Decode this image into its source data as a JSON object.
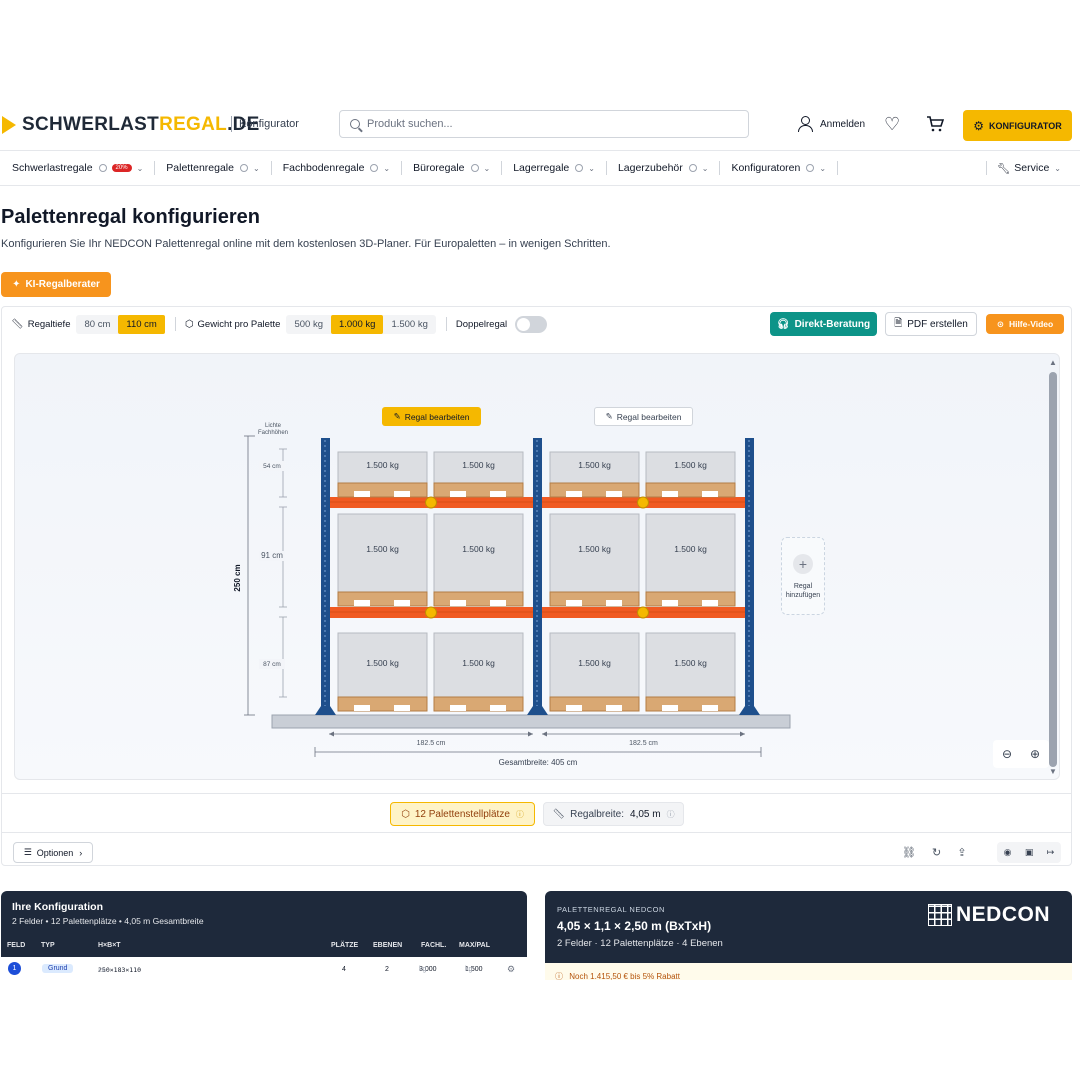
{
  "header": {
    "logo_main": "SCHWERLAST",
    "logo_accent": "REGAL",
    "logo_tld": ".DE",
    "logo_sub": "Konfigurator",
    "search_placeholder": "Produkt suchen...",
    "login_label": "Anmelden",
    "cta_label": "KONFIGURATOR"
  },
  "nav": {
    "items": [
      {
        "label": "Schwerlastregale",
        "badge": "20%"
      },
      {
        "label": "Palettenregale"
      },
      {
        "label": "Fachbodenregale"
      },
      {
        "label": "Büroregale"
      },
      {
        "label": "Lagerregale"
      },
      {
        "label": "Lagerzubehör"
      },
      {
        "label": "Konfiguratoren"
      }
    ],
    "service_label": "Service"
  },
  "page": {
    "title": "Palettenregal konfigurieren",
    "subtitle": "Konfigurieren Sie Ihr NEDCON Palettenregal online mit dem kostenlosen 3D-Planer. Für Europaletten – in wenigen Schritten.",
    "ki_button": "KI-Regalberater"
  },
  "toolbar": {
    "depth_label": "Regaltiefe",
    "depth_options": [
      "80 cm",
      "110 cm"
    ],
    "depth_selected": 1,
    "weight_label": "Gewicht pro Palette",
    "weight_options": [
      "500 kg",
      "1.000 kg",
      "1.500 kg"
    ],
    "weight_selected": 1,
    "double_label": "Doppelregal",
    "double_on": false,
    "consult_label": "Direkt-Beratung",
    "pdf_label": "PDF erstellen",
    "video_label": "Hilfe-Video"
  },
  "drawing": {
    "edit_label": "Regal bearbeiten",
    "lichte_label_1": "Lichte",
    "lichte_label_2": "Fachhöhen",
    "heights": [
      "54 cm",
      "91 cm",
      "87 cm"
    ],
    "total_height": "250 cm",
    "field_width_label": "182.5 cm",
    "total_width_label": "Gesamtbreite: 405 cm",
    "pallet_label": "1.500 kg",
    "add_label_1": "Regal",
    "add_label_2": "hinzufügen",
    "bays": 2,
    "levels": 3
  },
  "summary": {
    "pallet_places": "12 Palettenstellplätze",
    "width_label": "Regalbreite:",
    "width_value": "4,05 m",
    "options_label": "Optionen"
  },
  "config_card": {
    "title": "Ihre Konfiguration",
    "subtitle": "2 Felder • 12 Palettenplätze • 4,05 m Gesamtbreite",
    "columns": [
      "FELD",
      "TYP",
      "H×B×T",
      "PLÄTZE",
      "EBENEN",
      "FACHL.",
      "MAX/PAL"
    ],
    "row": {
      "feld": "1",
      "typ": "Grund",
      "dims": "250×183×110",
      "dims_unit": "cm",
      "plaetze": "4",
      "ebenen": "2",
      "fachl": "3.000",
      "fachl_unit": "kg",
      "maxpal": "1.500",
      "maxpal_unit": "kg"
    }
  },
  "product_card": {
    "kicker": "PALETTENREGAL NEDCON",
    "title": "4,05 × 1,1 × 2,50 m (BxTxH)",
    "subtitle": "2 Felder · 12 Palettenplätze · 4 Ebenen",
    "brand": "NEDCON",
    "promo": "Noch 1.415,50 € bis 5% Rabatt"
  },
  "colors": {
    "brand_yellow": "#f5b800",
    "orange": "#f7941d",
    "teal": "#0d9488",
    "upright_blue": "#1e4f8c",
    "beam_orange": "#f05a22",
    "dark_card": "#1e293b"
  }
}
